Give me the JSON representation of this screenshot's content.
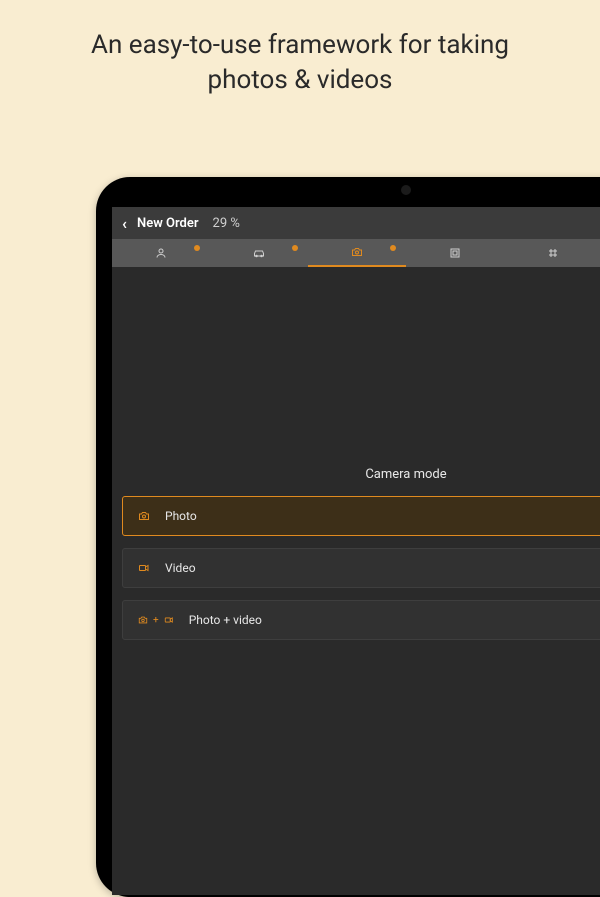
{
  "marketing": {
    "headline_line1": "An easy-to-use framework for taking",
    "headline_line2": "photos & videos"
  },
  "header": {
    "back_icon": "chevron-left",
    "title": "New Order",
    "progress_pct": "29 %"
  },
  "tabs": [
    {
      "icon": "user",
      "badge": true,
      "active": false
    },
    {
      "icon": "car",
      "badge": true,
      "active": false
    },
    {
      "icon": "camera",
      "badge": true,
      "active": true
    },
    {
      "icon": "square",
      "badge": false,
      "active": false
    },
    {
      "icon": "grid",
      "badge": false,
      "active": false
    },
    {
      "icon": "check",
      "badge": false,
      "active": false
    }
  ],
  "camera": {
    "section_title": "Camera mode",
    "modes": [
      {
        "icon": "photo",
        "label": "Photo",
        "selected": true
      },
      {
        "icon": "video",
        "label": "Video",
        "selected": false
      },
      {
        "icon": "photo-video",
        "label": "Photo + video",
        "selected": false
      }
    ]
  },
  "colors": {
    "accent": "#e08a1f",
    "bg_screen": "#2a2a2a",
    "bg_page": "#f9edd1"
  }
}
